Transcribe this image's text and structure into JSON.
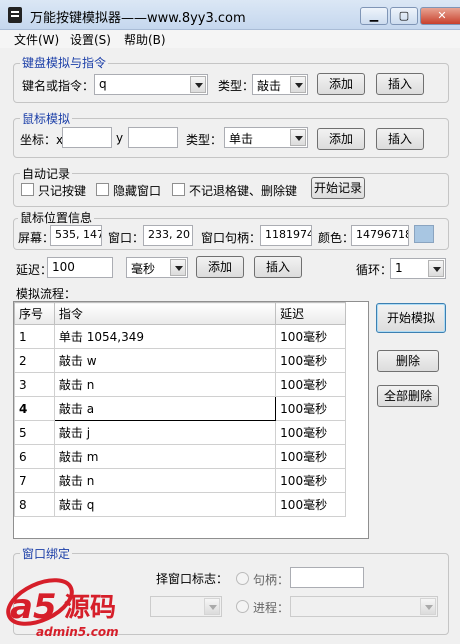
{
  "window": {
    "title": "万能按键模拟器——www.8yy3.com",
    "minimize": "▁",
    "maximize": "▢",
    "close": "✕"
  },
  "menu": {
    "file": "文件(W)",
    "settings": "设置(S)",
    "help": "帮助(B)"
  },
  "keyboard": {
    "group_label": "键盘模拟与指令",
    "key_label": "键名或指令：",
    "key_value": "q",
    "type_label": "类型：",
    "type_value": "敲击",
    "add": "添加",
    "insert": "插入"
  },
  "mouse": {
    "group_label": "鼠标模拟",
    "coord_label": "坐标：x",
    "x_value": "",
    "y_label": "y",
    "y_value": "",
    "type_label": "类型：",
    "type_value": "单击",
    "add": "添加",
    "insert": "插入"
  },
  "autorecord": {
    "group_label": "自动记录",
    "only_keys": "只记按键",
    "hide_window": "隐藏窗口",
    "skip_keys": "不记退格键、删除键",
    "start": "开始记录"
  },
  "mouseinfo": {
    "group_label": "鼠标位置信息",
    "screen_label": "屏幕：",
    "screen_value": "535, 147",
    "window_label": "窗口：",
    "window_value": "233, 20",
    "handle_label": "窗口句柄：",
    "handle_value": "1181974",
    "color_label": "颜色：",
    "color_value": "14796718",
    "color_swatch": "#a8c6e2"
  },
  "delay": {
    "label": "延迟：",
    "value": "100",
    "unit": "毫秒",
    "add": "添加",
    "insert": "插入",
    "loop_label": "循环：",
    "loop_value": "1"
  },
  "flow": {
    "label": "模拟流程：",
    "columns": [
      "序号",
      "指令",
      "延迟"
    ],
    "rows": [
      {
        "num": "1",
        "cmd": "单击 1054,349",
        "delay": "100毫秒"
      },
      {
        "num": "2",
        "cmd": "敲击 w",
        "delay": "100毫秒"
      },
      {
        "num": "3",
        "cmd": "敲击 n",
        "delay": "100毫秒"
      },
      {
        "num": "4",
        "cmd": "敲击 a",
        "delay": "100毫秒"
      },
      {
        "num": "5",
        "cmd": "敲击 j",
        "delay": "100毫秒"
      },
      {
        "num": "6",
        "cmd": "敲击 m",
        "delay": "100毫秒"
      },
      {
        "num": "7",
        "cmd": "敲击 n",
        "delay": "100毫秒"
      },
      {
        "num": "8",
        "cmd": "敲击 q",
        "delay": "100毫秒"
      }
    ],
    "start": "开始模拟",
    "delete": "删除",
    "delete_all": "全部删除"
  },
  "binding": {
    "group_label": "窗口绑定",
    "select_label": "择窗口标志：",
    "handle_label": "句柄：",
    "process_label": "进程："
  },
  "watermark": {
    "brand": "a5源码",
    "site": "admin5.com"
  }
}
